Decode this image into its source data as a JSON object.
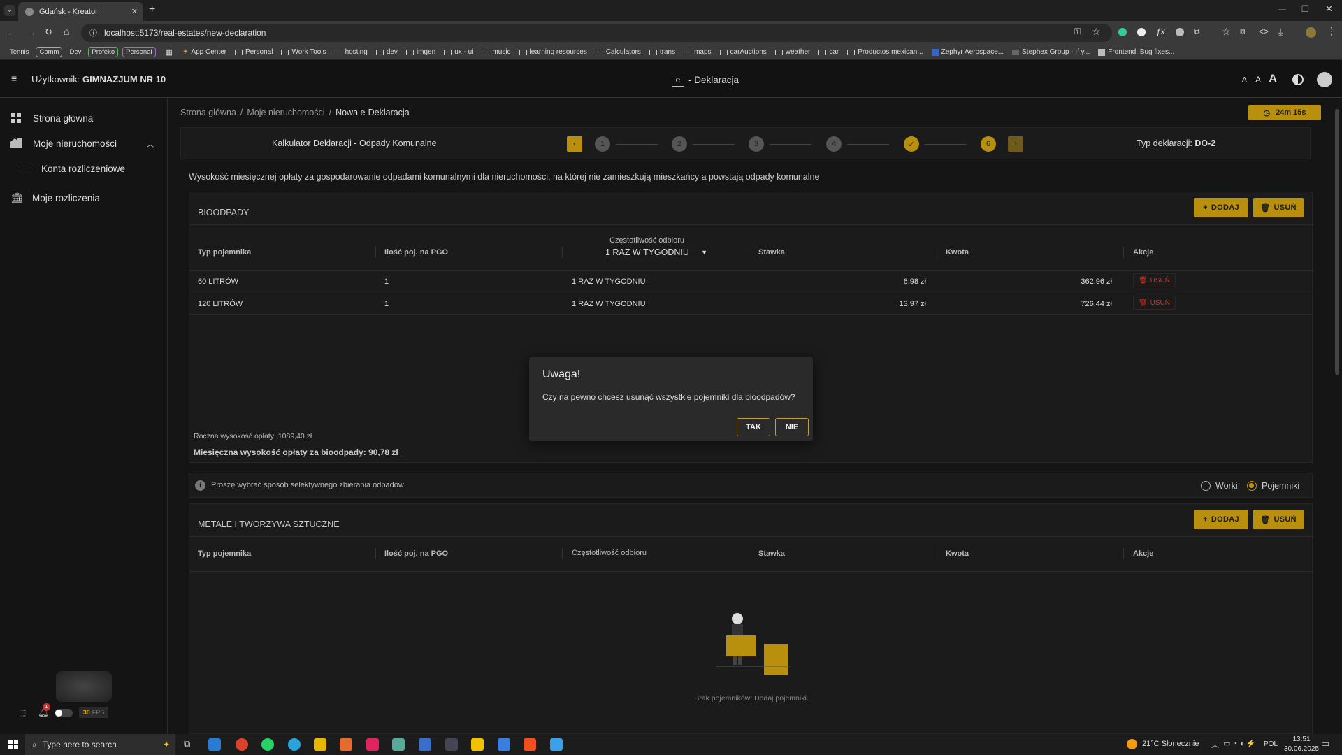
{
  "browser": {
    "tab_title": "Gdańsk - Kreator",
    "url": "localhost:5173/real-estates/new-declaration",
    "chips": [
      "Tennis",
      "Comm",
      "Dev",
      "Profeko",
      "Personal"
    ],
    "bookmarks": [
      "App Center",
      "Personal",
      "Work Tools",
      "hosting",
      "dev",
      "imgen",
      "ux - ui",
      "music",
      "learning resources",
      "Calculators",
      "trans",
      "maps",
      "carAuctions",
      "weather",
      "car",
      "Productos mexican...",
      "Zephyr Aerospace...",
      "Stephex Group - If y...",
      "Frontend: Bug fixes..."
    ]
  },
  "header": {
    "user_prefix": "Użytkownik:",
    "user_name": "GIMNAZJUM NR 10",
    "logo_letter": "e",
    "app_title": "- Deklaracja",
    "font_sizes": [
      "A",
      "A",
      "A"
    ]
  },
  "sidebar": {
    "items": [
      {
        "label": "Strona główna",
        "icon": "dashboard-icon"
      },
      {
        "label": "Moje nieruchomości",
        "icon": "buildings-icon"
      },
      {
        "label": "Konta rozliczeniowe",
        "icon": "ledger-icon"
      },
      {
        "label": "Moje rozliczenia",
        "icon": "bank-icon"
      }
    ],
    "notification_count": "1",
    "fps_value": "30",
    "fps_label": "FPS"
  },
  "breadcrumb": [
    "Strona główna",
    "Moje nieruchomości",
    "Nowa e-Deklaracja"
  ],
  "timer": "24m 15s",
  "wizard": {
    "title": "Kalkulator Deklaracji - Odpady Komunalne",
    "steps": [
      "1",
      "2",
      "3",
      "4",
      "✓",
      "6"
    ],
    "declaration_type_label": "Typ deklaracji:",
    "declaration_type_value": "DO-2"
  },
  "description": "Wysokość miesięcznej opłaty za gospodarowanie odpadami komunalnymi dla nieruchomości, na której nie zamieszkują mieszkańcy a powstają odpady komunalne",
  "bio": {
    "title": "BIOODPADY",
    "add_label": "DODAJ",
    "remove_label": "USUŃ",
    "columns": [
      "Typ pojemnika",
      "Ilość poj. na PGO",
      "Częstotliwość odbioru",
      "Stawka",
      "Kwota",
      "Akcje"
    ],
    "frequency_select": "1 RAZ W TYGODNIU",
    "rows": [
      {
        "type": "60 LITRÓW",
        "qty": "1",
        "freq": "1 RAZ W TYGODNIU",
        "rate": "6,98 zł",
        "amount": "362,96 zł",
        "action": "USUŃ"
      },
      {
        "type": "120 LITRÓW",
        "qty": "1",
        "freq": "1 RAZ W TYGODNIU",
        "rate": "13,97 zł",
        "amount": "726,44 zł",
        "action": "USUŃ"
      }
    ],
    "annual": "Roczna wysokość opłaty: 1089,40 zł",
    "monthly": "Miesięczna wysokość opłaty za bioodpady: 90,78 zł"
  },
  "collection": {
    "info": "Proszę wybrać sposób selektywnego zbierania odpadów",
    "options": [
      "Worki",
      "Pojemniki"
    ],
    "selected": "Pojemniki"
  },
  "metals": {
    "title": "METALE I TWORZYWA SZTUCZNE",
    "add_label": "DODAJ",
    "remove_label": "USUŃ",
    "columns": [
      "Typ pojemnika",
      "Ilość poj. na PGO",
      "Częstotliwość odbioru",
      "Stawka",
      "Kwota",
      "Akcje"
    ],
    "empty_text": "Brak pojemników! Dodaj pojemniki."
  },
  "modal": {
    "title": "Uwaga!",
    "message": "Czy na pewno chcesz usunąć wszystkie pojemniki dla bioodpadów?",
    "yes": "TAK",
    "no": "NIE"
  },
  "taskbar": {
    "search_placeholder": "Type here to search",
    "weather": "21°C Słonecznie",
    "lang": "POL",
    "time": "13:51",
    "date": "30.06.2025"
  },
  "colors": {
    "accent": "#b8900e",
    "danger": "#c0392b",
    "background": "#151515"
  }
}
